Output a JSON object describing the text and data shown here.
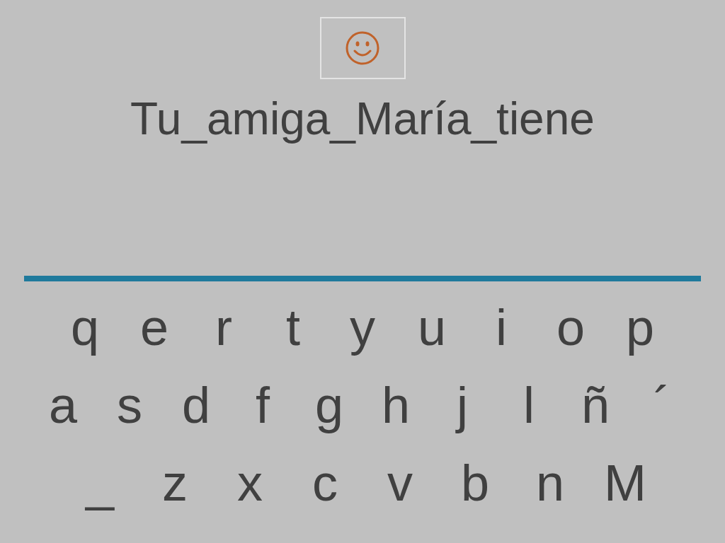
{
  "sentence": "Tu_amiga_María_tiene",
  "keyboard": {
    "rows": [
      [
        "q",
        "e",
        "r",
        "t",
        "y",
        "u",
        "i",
        "o",
        "p"
      ],
      [
        "a",
        "s",
        "d",
        "f",
        "g",
        "h",
        "j",
        "l",
        "ñ",
        "´"
      ],
      [
        "_",
        "z",
        "x",
        "c",
        "v",
        "b",
        "n",
        "M"
      ]
    ]
  }
}
